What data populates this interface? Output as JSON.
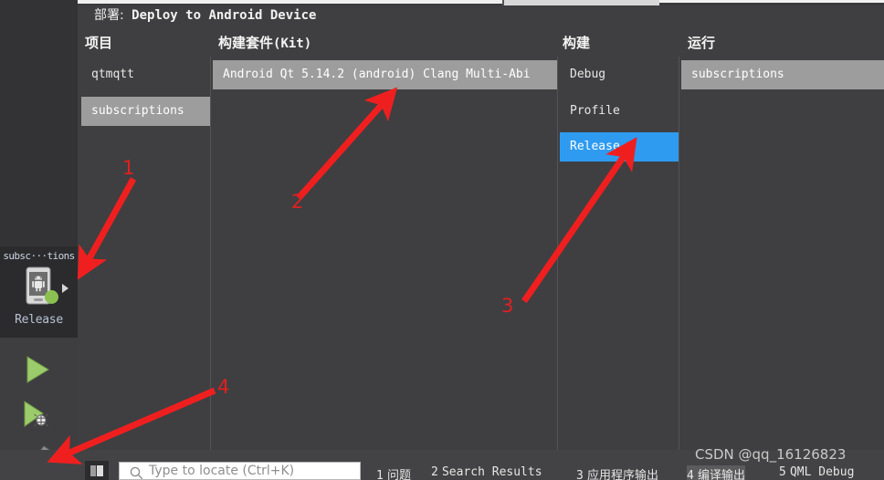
{
  "window": {
    "title_prefix": "部署:",
    "title": "Deploy to Android Device"
  },
  "columns": [
    {
      "id": "project",
      "label": "项目"
    },
    {
      "id": "kit",
      "label": "构建套件(Kit)"
    },
    {
      "id": "build",
      "label": "构建"
    },
    {
      "id": "run",
      "label": "运行"
    }
  ],
  "lists": {
    "project": {
      "items": [
        {
          "label": "qtmqtt",
          "selected": false
        },
        {
          "label": "subscriptions",
          "selected": true
        }
      ]
    },
    "kit": {
      "items": [
        {
          "label": "Android Qt 5.14.2 (android) Clang Multi-Abi",
          "selected": true
        }
      ]
    },
    "build": {
      "items": [
        {
          "label": "Debug",
          "selected": false
        },
        {
          "label": "Profile",
          "selected": false
        },
        {
          "label": "Release",
          "selected": true
        }
      ]
    },
    "run": {
      "items": [
        {
          "label": "subscriptions",
          "selected": true
        }
      ]
    }
  },
  "sidebar": {
    "target_selector": {
      "project_name": "subsc···tions",
      "config_name": "Release",
      "device_icon": "android-phone-icon",
      "status_dot": "green-status-dot",
      "expand_icon": "caret-right-icon"
    },
    "buttons": [
      {
        "id": "run",
        "icon": "run-play-icon"
      },
      {
        "id": "debug",
        "icon": "debug-bug-icon"
      },
      {
        "id": "build",
        "icon": "build-hammer-icon"
      }
    ]
  },
  "bottom_bar": {
    "toggle_icon": "output-pane-toggle-icon",
    "search": {
      "icon": "search-icon",
      "placeholder": "Type to locate (Ctrl+K)",
      "value": ""
    },
    "panes": [
      {
        "num": "1",
        "label": "问题",
        "active": false
      },
      {
        "num": "2",
        "label": "Search Results",
        "active": false
      },
      {
        "num": "3",
        "label": "应用程序输出",
        "active": false
      },
      {
        "num": "4",
        "label": "编译输出",
        "active": true
      },
      {
        "num": "5",
        "label": "QML Debug",
        "active": false
      }
    ]
  },
  "watermark": "CSDN @qq_16126823",
  "annotations": [
    {
      "num": "1",
      "target": "target-selector"
    },
    {
      "num": "2",
      "target": "kit-row"
    },
    {
      "num": "3",
      "target": "release-row"
    },
    {
      "num": "4",
      "target": "build-hammer-button"
    }
  ],
  "colors": {
    "panel_bg": "#3f3f41",
    "selection_blue": "#2e9bf0",
    "selection_gray": "#9d9d9d",
    "annotation_red": "#e02020",
    "status_green": "#8cc152"
  }
}
